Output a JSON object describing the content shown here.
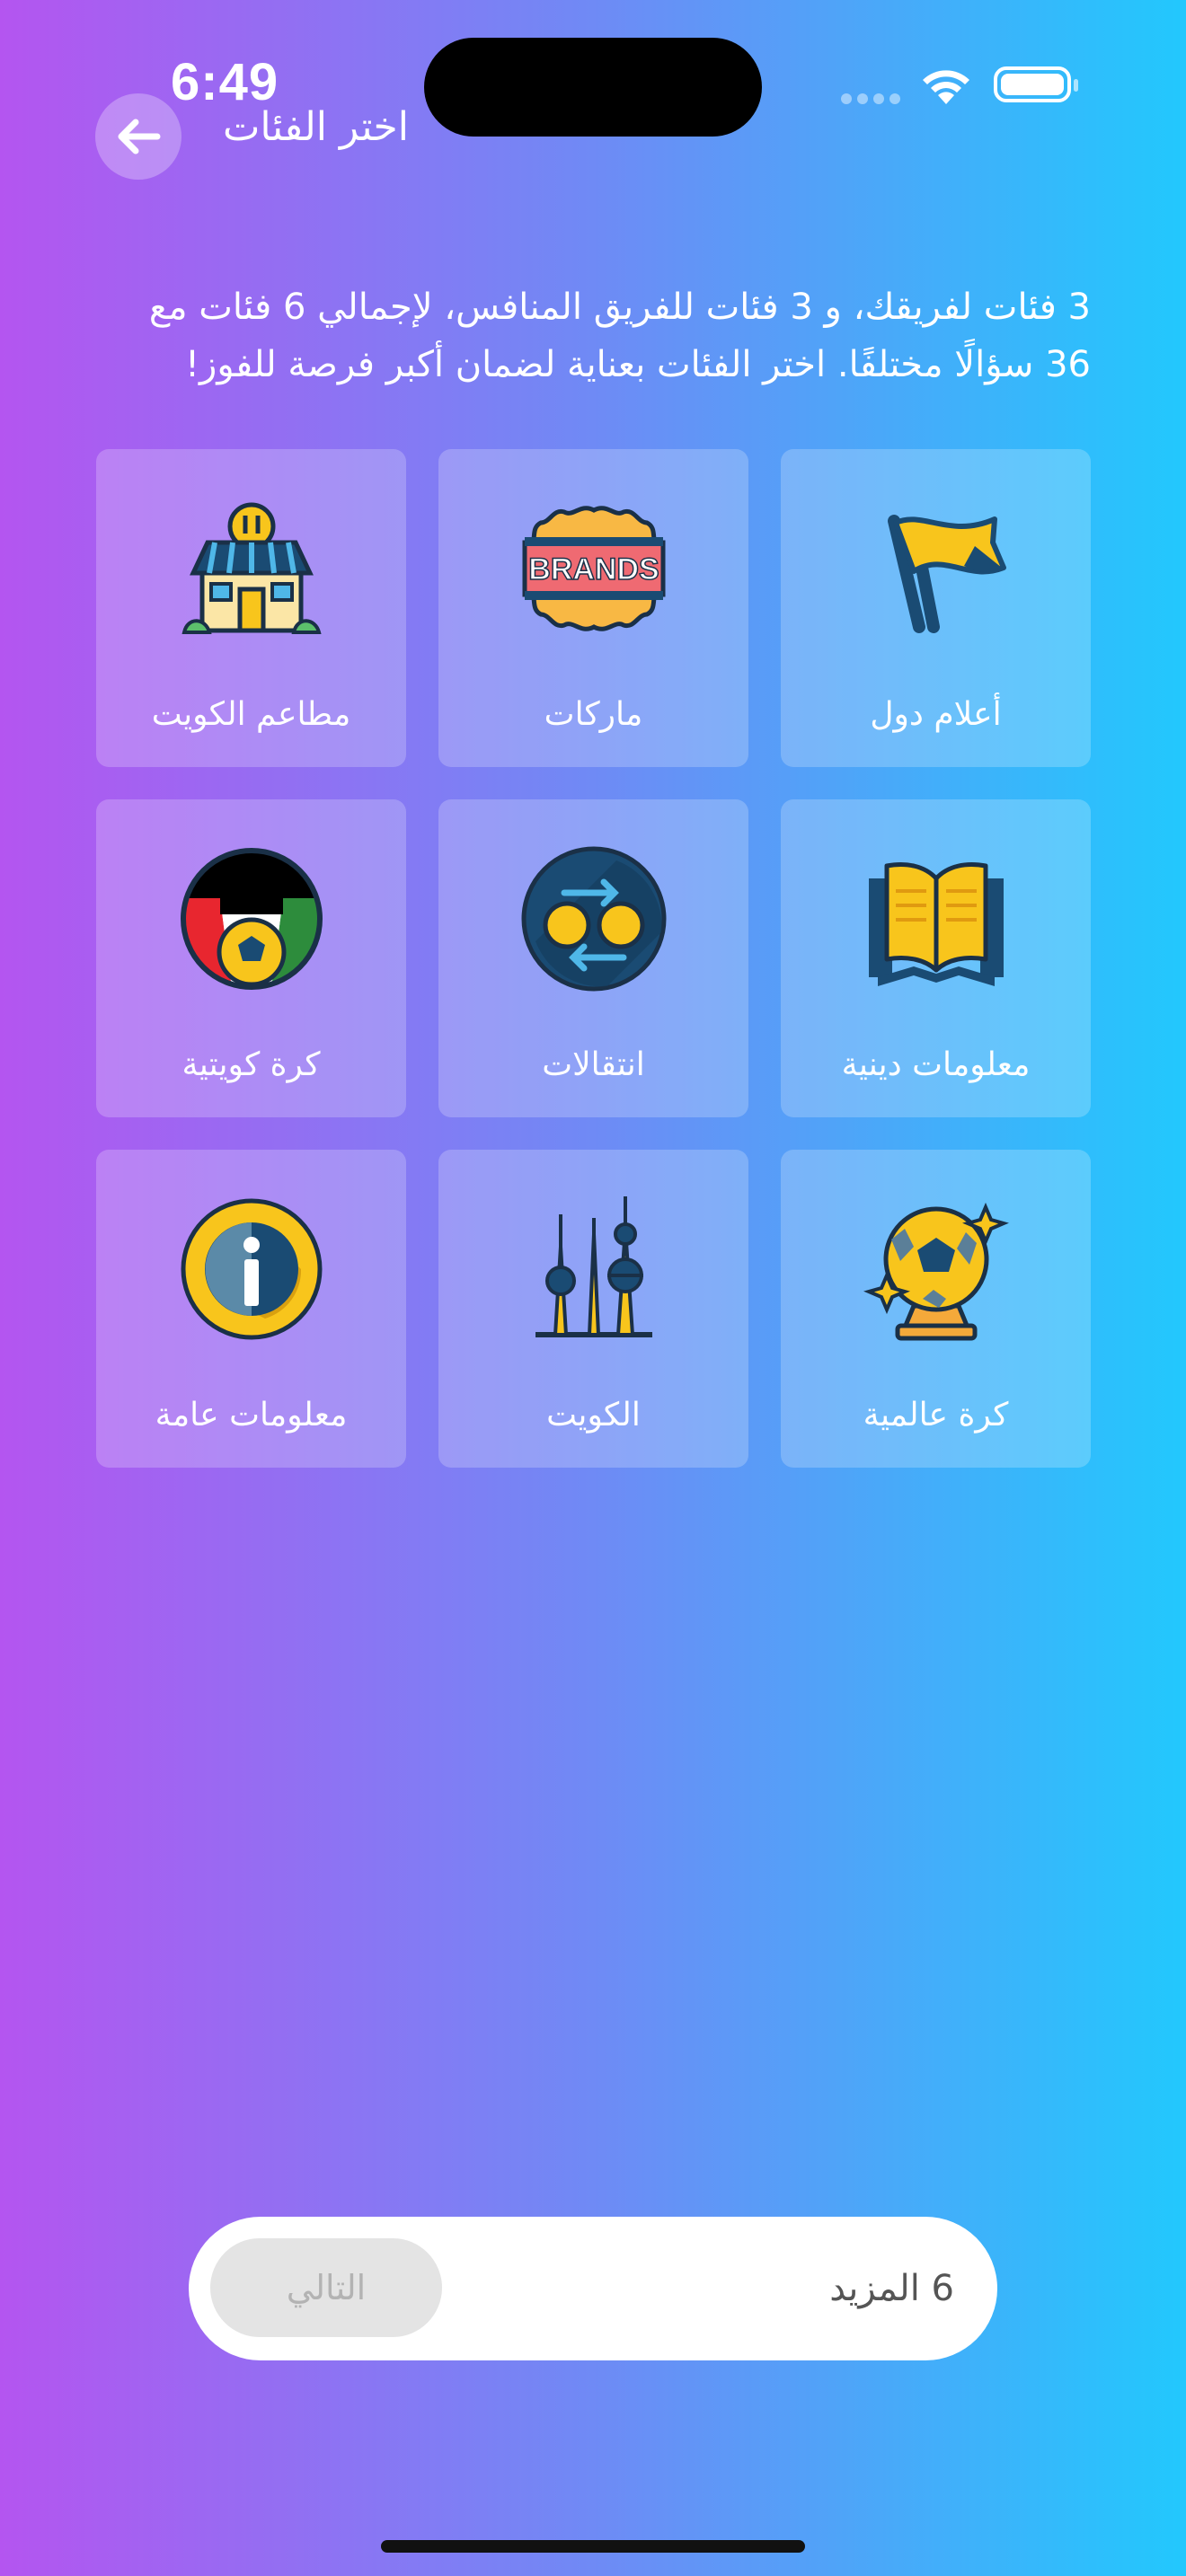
{
  "status": {
    "time": "6:49"
  },
  "header": {
    "title": "اختر الفئات"
  },
  "intro_text": "3 فئات لفريقك، و 3 فئات للفريق المنافس، لإجمالي 6 فئات مع 36 سؤالًا مختلفًا. اختر الفئات بعناية لضمان أكبر فرصة للفوز!",
  "categories": [
    {
      "label": "أعلام دول",
      "icon": "flag-icon"
    },
    {
      "label": "ماركات",
      "icon": "brands-badge-icon",
      "badge_text": "BRANDS"
    },
    {
      "label": "مطاعم الكويت",
      "icon": "restaurant-icon"
    },
    {
      "label": "معلومات دينية",
      "icon": "open-book-icon"
    },
    {
      "label": "انتقالات",
      "icon": "transfer-coins-icon"
    },
    {
      "label": "كرة كويتية",
      "icon": "kuwait-football-icon"
    },
    {
      "label": "كرة عالمية",
      "icon": "globe-football-trophy-icon"
    },
    {
      "label": "الكويت",
      "icon": "kuwait-towers-icon"
    },
    {
      "label": "معلومات عامة",
      "icon": "info-icon"
    }
  ],
  "bottom_bar": {
    "next_label": "التالي",
    "more_label": "6 المزيد"
  },
  "colors": {
    "gradient_left": "#b455f0",
    "gradient_right": "#22c8fd",
    "icon_yellow": "#f8c51c",
    "icon_navy": "#1a4b73"
  }
}
